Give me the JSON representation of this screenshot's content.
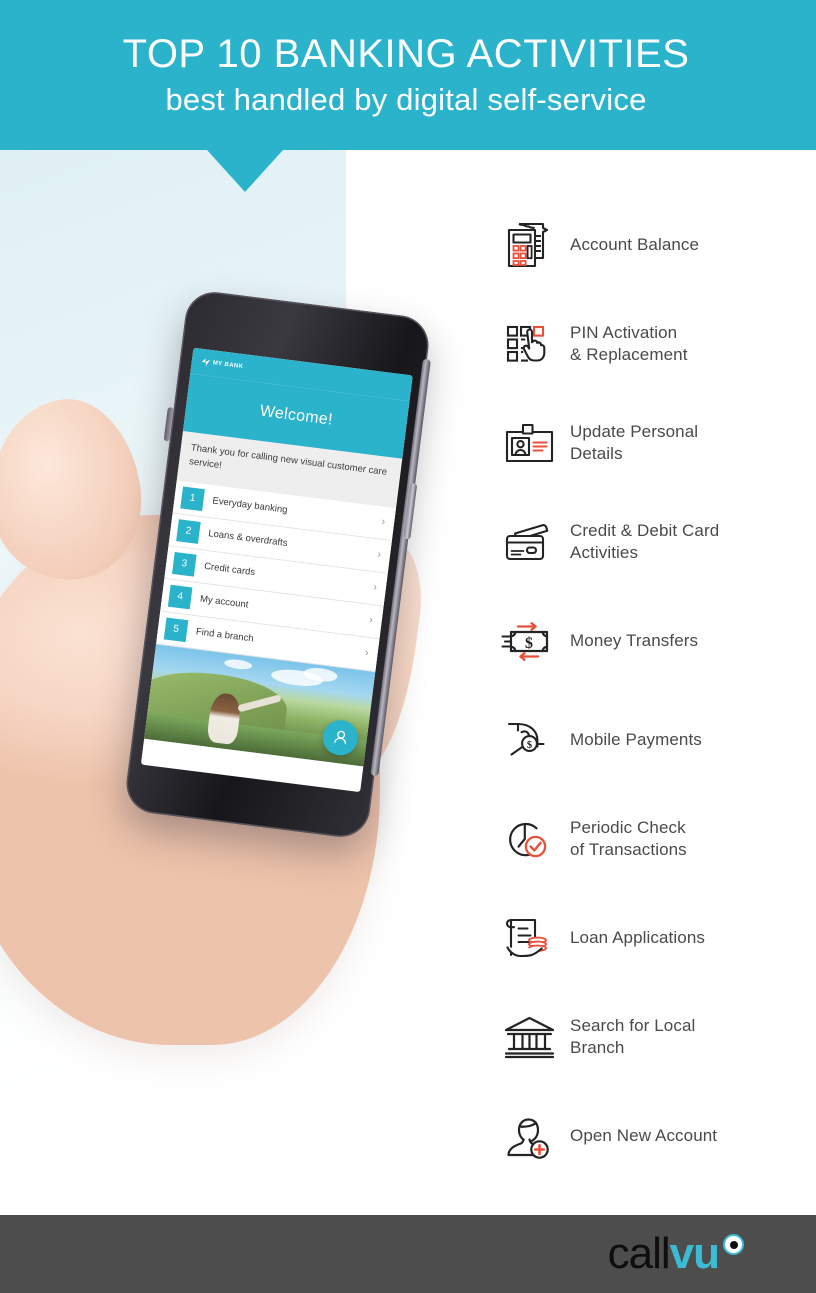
{
  "header": {
    "title": "TOP 10 BANKING ACTIVITIES",
    "subtitle": "best handled by digital self-service",
    "background_color": "#2bb3cc",
    "text_color": "#ffffff"
  },
  "phone": {
    "app": {
      "brand": "MY BANK",
      "welcome_title": "Welcome!",
      "message": "Thank you for calling new visual customer care service!",
      "menu": [
        {
          "number": "1",
          "label": "Everyday banking",
          "chevron": "›"
        },
        {
          "number": "2",
          "label": "Loans & overdrafts",
          "chevron": "›"
        },
        {
          "number": "3",
          "label": "Credit cards",
          "chevron": "›"
        },
        {
          "number": "4",
          "label": "My account",
          "chevron": "›"
        },
        {
          "number": "5",
          "label": "Find a branch",
          "chevron": "›"
        }
      ],
      "avatar_button_icon": "person-avatar-icon",
      "accent_color": "#2bb3cc"
    }
  },
  "activities": [
    {
      "label": "Account Balance",
      "icon": "calculator-receipt-icon"
    },
    {
      "label": "PIN Activation\n& Replacement",
      "icon": "pin-keypad-hand-icon"
    },
    {
      "label": "Update Personal\nDetails",
      "icon": "id-card-icon"
    },
    {
      "label": "Credit & Debit Card\nActivities",
      "icon": "credit-cards-icon"
    },
    {
      "label": "Money Transfers",
      "icon": "banknote-transfer-icon"
    },
    {
      "label": "Mobile Payments",
      "icon": "hand-coin-icon"
    },
    {
      "label": "Periodic Check\nof Transactions",
      "icon": "clock-check-icon"
    },
    {
      "label": "Loan Applications",
      "icon": "document-coins-hand-icon"
    },
    {
      "label": "Search for Local\nBranch",
      "icon": "bank-building-icon"
    },
    {
      "label": "Open New Account",
      "icon": "person-plus-icon"
    }
  ],
  "footer": {
    "brand_part_1": "call",
    "brand_part_2": "vu",
    "background_color": "#4d4d4d",
    "brand_accent_color": "#3cbcd4"
  },
  "colors": {
    "teal": "#2bb3cc",
    "red_accent": "#e8503a",
    "icon_stroke": "#232323",
    "label_text": "#4a4a4a"
  }
}
